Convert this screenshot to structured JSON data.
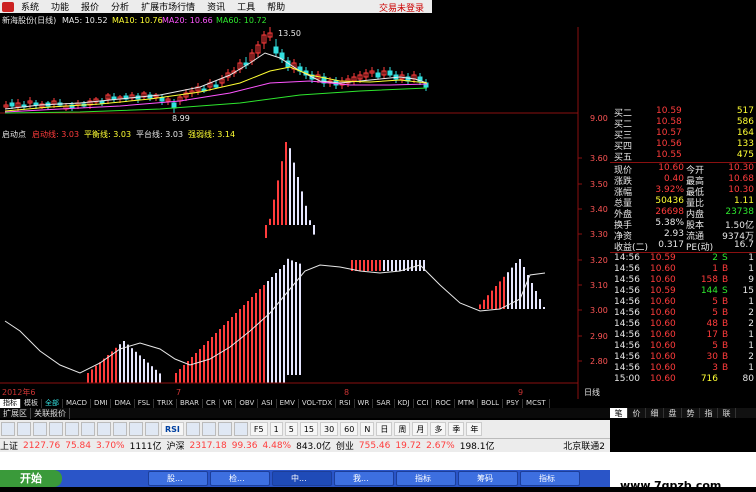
{
  "menu": {
    "items": [
      "系统",
      "功能",
      "报价",
      "分析",
      "扩展市场行情",
      "资讯",
      "工具",
      "帮助"
    ],
    "login": "交易未登录"
  },
  "kline": {
    "title": "新海股份(日线)",
    "ma5": "MA5: 10.52",
    "ma10": "MA10: 10.76",
    "ma20": "MA20: 10.66",
    "ma60": "MA60: 10.72",
    "high_label": "13.50",
    "low_label": "8.99",
    "price_axis": "9.00"
  },
  "indicator": {
    "start_label": "启动点",
    "start_val": "启动线: 3.03",
    "flat_val": "平衡线: 3.03",
    "platform_val": "平台线: 3.03",
    "strong_val": "强弱线: 3.14",
    "axis": [
      "3.60",
      "3.50",
      "3.40",
      "3.30",
      "3.20",
      "3.10",
      "3.00",
      "2.90",
      "2.80"
    ],
    "date_labels": [
      "2012年6",
      "7",
      "8",
      "9"
    ],
    "period_label": "日线"
  },
  "quote": {
    "rows": [
      {
        "l": "买二",
        "p": "10.59",
        "v": "517"
      },
      {
        "l": "买二",
        "p": "10.58",
        "v": "586"
      },
      {
        "l": "买三",
        "p": "10.57",
        "v": "164"
      },
      {
        "l": "买四",
        "p": "10.56",
        "v": "133"
      },
      {
        "l": "买五",
        "p": "10.55",
        "v": "475"
      }
    ],
    "stats": [
      {
        "l1": "现价",
        "v1": "10.60",
        "l2": "今开",
        "v2": "10.30"
      },
      {
        "l1": "涨跌",
        "v1": "0.40",
        "l2": "最高",
        "v2": "10.68"
      },
      {
        "l1": "涨幅",
        "v1": "3.92%",
        "l2": "最低",
        "v2": "10.30"
      },
      {
        "l1": "总量",
        "v1": "50436",
        "l2": "量比",
        "v2": "1.11"
      },
      {
        "l1": "外盘",
        "v1": "26698",
        "l2": "内盘",
        "v2": "23738"
      },
      {
        "l1": "换手",
        "v1": "5.38%",
        "l2": "股本",
        "v2": "1.50亿"
      },
      {
        "l1": "净资",
        "v1": "2.93",
        "l2": "流通",
        "v2": "9374万"
      },
      {
        "l1": "收益(二)",
        "v1": "0.317",
        "l2": "PE(动)",
        "v2": "16.7"
      }
    ],
    "ticks": [
      {
        "t": "14:56",
        "p": "10.59",
        "v": "2",
        "s": "S",
        "n": "1"
      },
      {
        "t": "14:56",
        "p": "10.60",
        "v": "1",
        "s": "B",
        "n": "1"
      },
      {
        "t": "14:56",
        "p": "10.60",
        "v": "158",
        "s": "B",
        "n": "9"
      },
      {
        "t": "14:56",
        "p": "10.59",
        "v": "144",
        "s": "S",
        "n": "15"
      },
      {
        "t": "14:56",
        "p": "10.60",
        "v": "5",
        "s": "B",
        "n": "1"
      },
      {
        "t": "14:56",
        "p": "10.60",
        "v": "5",
        "s": "B",
        "n": "2"
      },
      {
        "t": "14:56",
        "p": "10.60",
        "v": "48",
        "s": "B",
        "n": "2"
      },
      {
        "t": "14:56",
        "p": "10.60",
        "v": "17",
        "s": "B",
        "n": "1"
      },
      {
        "t": "14:56",
        "p": "10.60",
        "v": "5",
        "s": "B",
        "n": "1"
      },
      {
        "t": "14:56",
        "p": "10.60",
        "v": "30",
        "s": "B",
        "n": "2"
      },
      {
        "t": "14:56",
        "p": "10.60",
        "v": "3",
        "s": "B",
        "n": "1"
      },
      {
        "t": "15:00",
        "p": "10.60",
        "v": "716",
        "s": "",
        "n": "80"
      }
    ]
  },
  "indicator_tabs": [
    "指标",
    "模板",
    "全部",
    "MACD",
    "DMI",
    "DMA",
    "FSL",
    "TRIX",
    "BRAR",
    "CR",
    "VR",
    "OBV",
    "ASI",
    "EMV",
    "VOL-TDX",
    "RSI",
    "WR",
    "SAR",
    "KDJ",
    "CCI",
    "ROC",
    "MTM",
    "BOLL",
    "PSY",
    "MCST"
  ],
  "sub_tabs": [
    "扩展区",
    "关联报价"
  ],
  "right_tabs": [
    "笔",
    "价",
    "细",
    "盘",
    "势",
    "指",
    "联"
  ],
  "toolbar": {
    "rsi": "RSI",
    "periods": [
      "1",
      "5",
      "15",
      "30",
      "60",
      "N",
      "日",
      "周",
      "月",
      "多",
      "季",
      "年"
    ],
    "f5": "F5"
  },
  "ticker": {
    "items": [
      {
        "name": "上证",
        "val": "2127.76",
        "chg": "75.84",
        "pct": "3.70%",
        "amt": "1111亿"
      },
      {
        "name": "沪深",
        "val": "2317.18",
        "chg": "99.36",
        "pct": "4.48%",
        "amt": "843.0亿"
      },
      {
        "name": "创业",
        "val": "",
        "chg": "755.46",
        "pct": "19.72",
        "amt": "2.67%"
      },
      {
        "name": "",
        "val": "198.1亿",
        "chg": "",
        "pct": "",
        "amt": ""
      }
    ],
    "right": "北京联通2"
  },
  "taskbar": {
    "start": "开始",
    "buttons": [
      "股...",
      "检...",
      "中...",
      "我...",
      "指标",
      "筹码",
      "指标"
    ]
  },
  "watermark": "www.7gpzb.com",
  "colors": {
    "up": "#ff3c3c",
    "down": "#2ee62e",
    "price": "#e8e8e8",
    "bg": "#000000"
  }
}
